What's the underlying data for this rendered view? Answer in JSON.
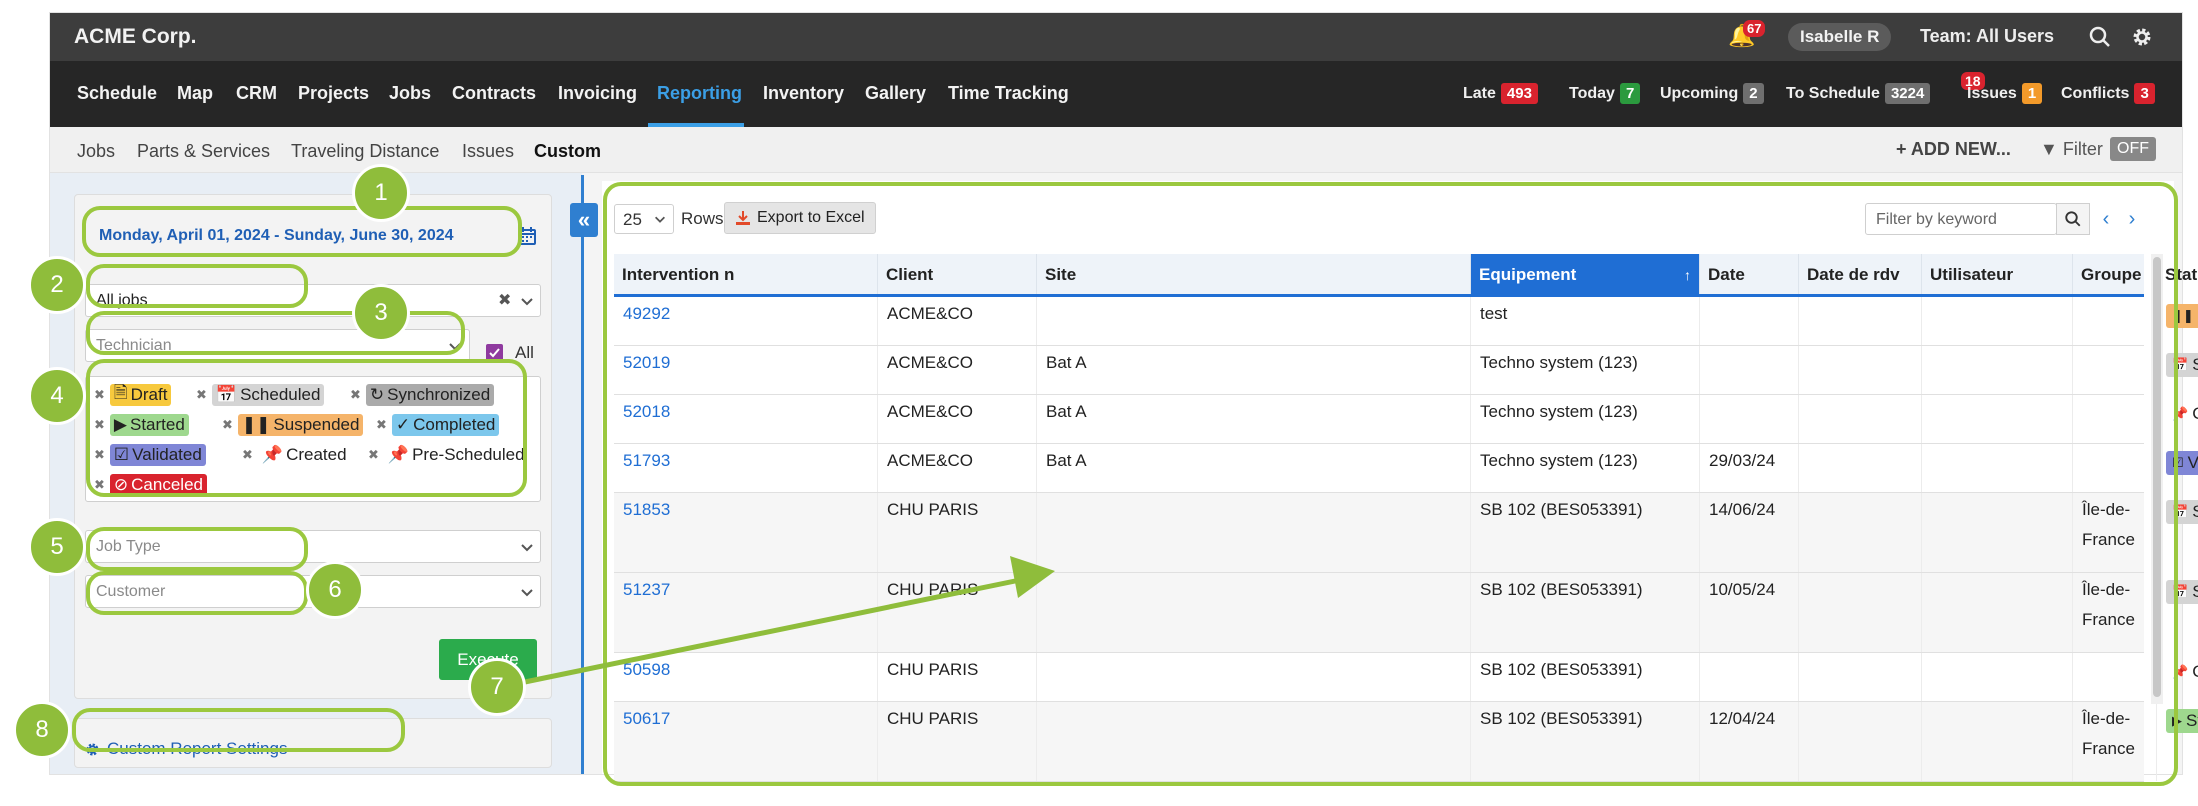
{
  "app": {
    "name": "ACME Corp."
  },
  "topbar": {
    "notifications": "67",
    "user": "Isabelle R",
    "team": "Team: All Users"
  },
  "nav": {
    "items": [
      "Schedule",
      "Map",
      "CRM",
      "Projects",
      "Jobs",
      "Contracts",
      "Invoicing",
      "Reporting",
      "Inventory",
      "Gallery",
      "Time Tracking"
    ],
    "active": "Reporting",
    "stats": [
      {
        "label": "Late",
        "count": "493",
        "color": "#d9232e"
      },
      {
        "label": "Today",
        "count": "7",
        "color": "#2b9a3e"
      },
      {
        "label": "Upcoming",
        "count": "2",
        "color": "#6f6f6f"
      },
      {
        "label": "To Schedule",
        "count": "3224",
        "color": "#6f6f6f",
        "extra": "18"
      },
      {
        "label": "Issues",
        "count": "1",
        "color": "#f39a2a"
      },
      {
        "label": "Conflicts",
        "count": "3",
        "color": "#d9232e"
      }
    ]
  },
  "subnav": {
    "items": [
      "Jobs",
      "Parts & Services",
      "Traveling Distance",
      "Issues",
      "Custom"
    ],
    "active": "Custom",
    "add_new": "+ ADD NEW...",
    "filter": "Filter",
    "filter_state": "OFF"
  },
  "sidebar": {
    "date_range": "Monday, April 01, 2024 - Sunday, June 30, 2024",
    "jobs_select": "All jobs",
    "technician_placeholder": "Technician",
    "all_label": "All",
    "statuses": [
      "Draft",
      "Scheduled",
      "Synchronized",
      "Started",
      "Suspended",
      "Completed",
      "Validated",
      "Created",
      "Pre-Scheduled",
      "Canceled"
    ],
    "job_type_placeholder": "Job Type",
    "customer_placeholder": "Customer",
    "execute": "Execute",
    "settings_link": "Custom Report Settings"
  },
  "table": {
    "rows_per_page": "25",
    "rows_label": "Rows",
    "export_label": "Export to Excel",
    "keyword_placeholder": "Filter by keyword",
    "columns": [
      "Intervention n",
      "Client",
      "Site",
      "Equipement",
      "Date",
      "Date de rdv",
      "Utilisateur",
      "Groupe",
      "Statut"
    ],
    "sorted_column": "Equipement",
    "rows": [
      {
        "id": "49292",
        "client": "ACME&CO",
        "site": "",
        "equipment": "test",
        "date": "",
        "date_rdv": "",
        "user": "",
        "group": "",
        "status": "Paused"
      },
      {
        "id": "52019",
        "client": "ACME&CO",
        "site": "Bat A",
        "equipment": "Techno system (123)",
        "date": "",
        "date_rdv": "",
        "user": "",
        "group": "",
        "status": "Scheduled"
      },
      {
        "id": "52018",
        "client": "ACME&CO",
        "site": "Bat A",
        "equipment": "Techno system (123)",
        "date": "",
        "date_rdv": "",
        "user": "",
        "group": "",
        "status": "Created"
      },
      {
        "id": "51793",
        "client": "ACME&CO",
        "site": "Bat A",
        "equipment": "Techno system (123)",
        "date": "29/03/24",
        "date_rdv": "",
        "user": "",
        "group": "",
        "status": "Validated"
      },
      {
        "id": "51853",
        "client": "CHU PARIS",
        "site": "",
        "equipment": "SB 102 (BES053391)",
        "date": "14/06/24",
        "date_rdv": "",
        "user": "",
        "group": "Île-de-France",
        "status": "Scheduled"
      },
      {
        "id": "51237",
        "client": "CHU PARIS",
        "site": "",
        "equipment": "SB 102 (BES053391)",
        "date": "10/05/24",
        "date_rdv": "",
        "user": "",
        "group": "Île-de-France",
        "status": "Scheduled"
      },
      {
        "id": "50598",
        "client": "CHU PARIS",
        "site": "",
        "equipment": "SB 102 (BES053391)",
        "date": "",
        "date_rdv": "",
        "user": "",
        "group": "",
        "status": "Created"
      },
      {
        "id": "50617",
        "client": "CHU PARIS",
        "site": "",
        "equipment": "SB 102 (BES053391)",
        "date": "12/04/24",
        "date_rdv": "",
        "user": "",
        "group": "Île-de-France",
        "status": "Started"
      }
    ]
  },
  "callouts": [
    "1",
    "2",
    "3",
    "4",
    "5",
    "6",
    "7",
    "8"
  ]
}
